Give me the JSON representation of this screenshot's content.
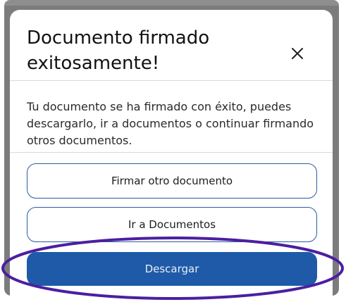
{
  "dialog": {
    "title": "Documento firmado exitosamente!",
    "close_icon": "close-icon",
    "message": "Tu documento se ha firmado con éxito, puedes descargarlo, ir a documentos o continuar firmando otros documentos."
  },
  "actions": {
    "sign_another_label": "Firmar otro documento",
    "go_documents_label": "Ir a Documentos",
    "download_label": "Descargar"
  },
  "colors": {
    "primary": "#1e5aa8",
    "outline": "#2a5da3",
    "annotation": "#4b1fa0",
    "backdrop": "#7c7c7c"
  }
}
